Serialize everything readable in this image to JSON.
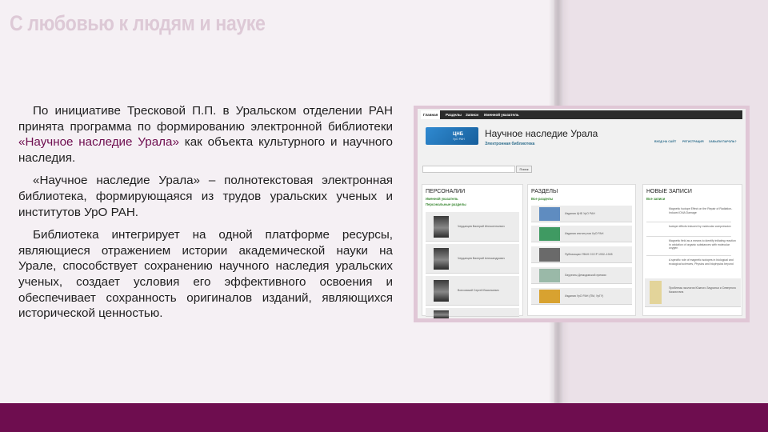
{
  "slide": {
    "title": "С любовью к людям и науке",
    "p1_a": "По инициативе Тресковой П.П. в Уральском отделении РАН принята программа по формированию электронной библиотеки ",
    "p1_highlight": "«Научное наследие Урала»",
    "p1_b": " как объекта культурного и научного наследия.",
    "p2": "«Научное наследие Урала» – полнотекстовая электронная библиотека, формирующаяся из трудов уральских ученых и институтов УрО РАН.",
    "p3": "Библиотека интегрирует на одной платформе ресурсы, являющиеся отражением истории академической науки на Урале, способствует сохранению научного наследия уральских ученых, создает условия его эффективного освоения и обеспечивает сохранность оригиналов изданий, являющихся исторической ценностью."
  },
  "colors": {
    "accent": "#6e0d4f",
    "title_tint": "#ddc9d6",
    "green_link": "#3d8a36"
  },
  "site": {
    "nav": [
      "Главная",
      "Разделы",
      "Записи",
      "Именной указатель"
    ],
    "logo_text": "ЦНБ",
    "logo_sub": "УрО РАН",
    "title": "Научное наследие Урала",
    "subtitle": "Электронная библиотека",
    "login": [
      "ВХОД НА САЙТ",
      "РЕГИСТРАЦИЯ",
      "ЗАБЫЛИ ПАРОЛЬ?"
    ],
    "search_button": "Поиск",
    "personalii": {
      "title": "ПЕРСОНАЛИИ",
      "links": [
        "Именной указатель",
        "Персональные разделы"
      ],
      "people": [
        "Черданцев Валерий Иннокентьевич",
        "Черданцев Валерий Александрович",
        "Вонсовский Сергей Васильевич"
      ]
    },
    "razdely": {
      "title": "РАЗДЕЛЫ",
      "link": "Все разделы",
      "items": [
        "Издания ЦНБ УрО РАН",
        "Издания институтов УрО РАН",
        "Публикации УФАН СССР 1932–1945",
        "Лауреаты Демидовской премии",
        "Издания УрО РАН (ПМ, УрГУ)"
      ]
    },
    "zapisi": {
      "title": "НОВЫЕ ЗАПИСИ",
      "link": "Все записи",
      "items": [
        "Magnetic Isotope Effect on the Repair of Radiation-Induced DNA Damage",
        "Isotope effects induced by molecular compression",
        "Magnetic field as a means to identify initiating reaction in oxidation of organic substances with molecular oxygen",
        "A specific role of magnetic isotopes in biological and ecological sciences, Physics and biophysics beyond",
        "Проблемы экологии Южного Зауралья и Северного Казахстана"
      ]
    }
  }
}
